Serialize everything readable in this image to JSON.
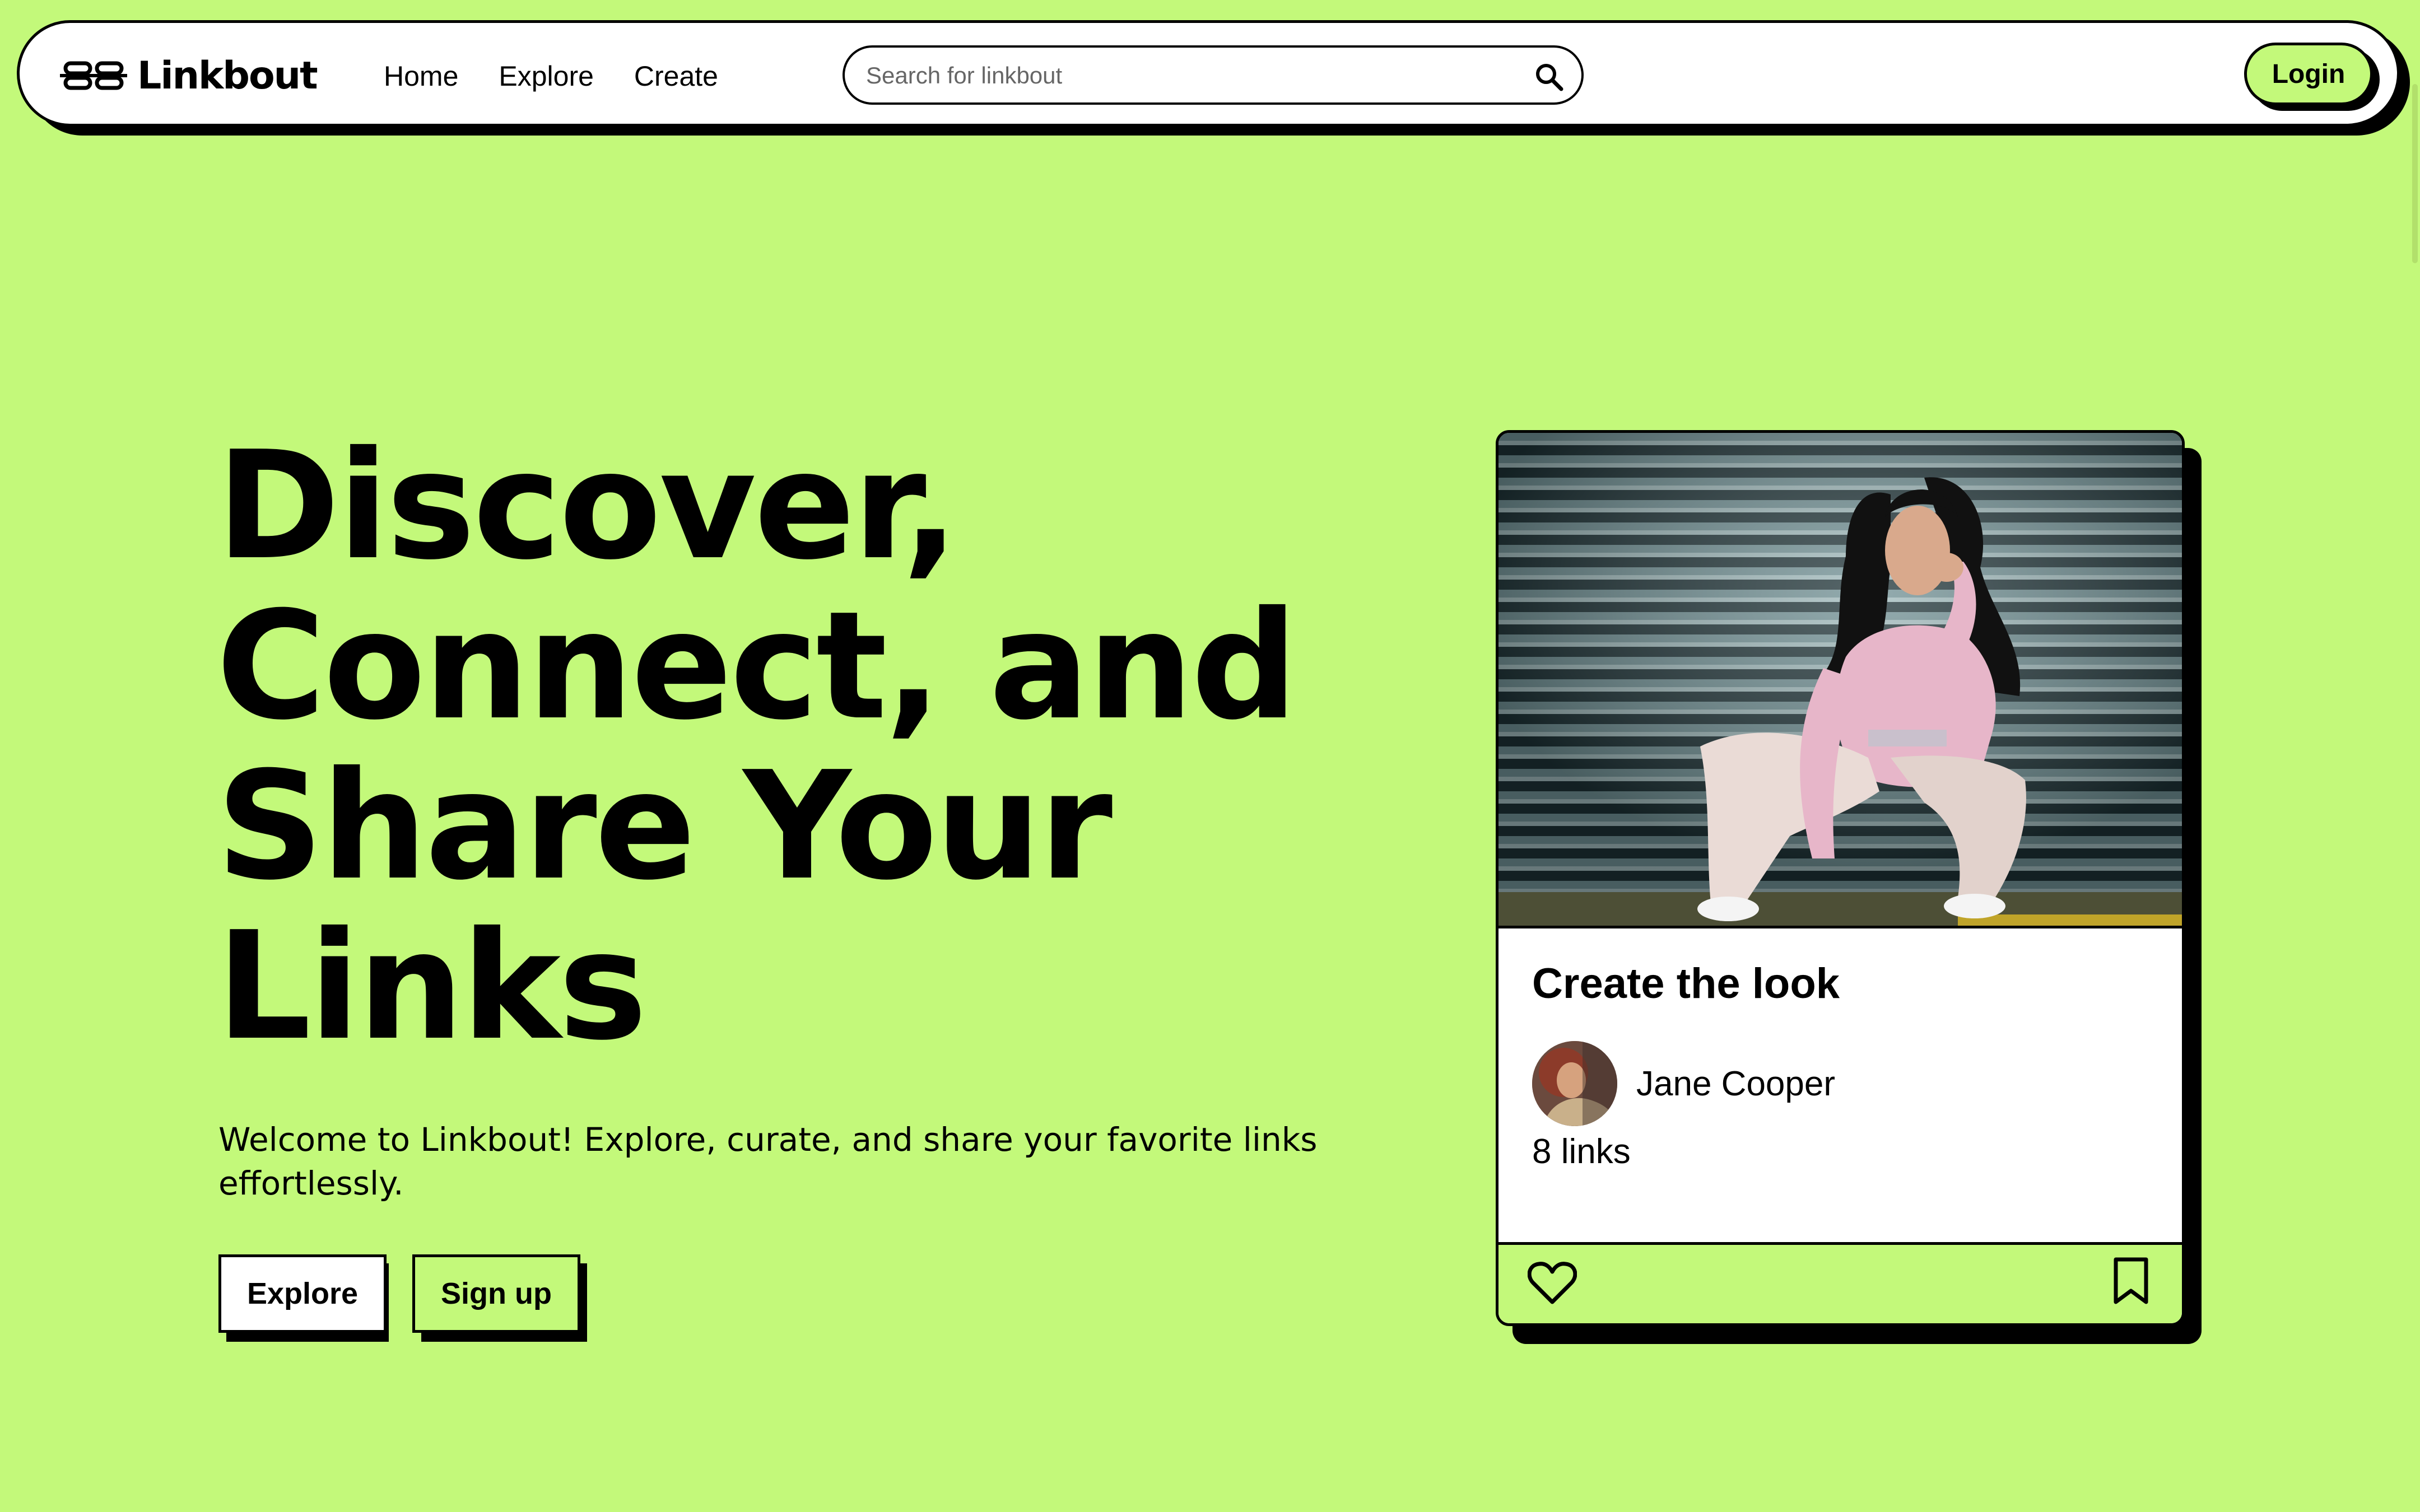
{
  "header": {
    "logo_text": "Linkbout",
    "logo_icon": "chain-link-icon",
    "nav": [
      {
        "label": "Home"
      },
      {
        "label": "Explore"
      },
      {
        "label": "Create"
      }
    ],
    "search": {
      "placeholder": "Search for linkbout",
      "icon": "search-icon"
    },
    "login_label": "Login"
  },
  "hero": {
    "title_lines": [
      "Discover,",
      "Connect, and",
      "Share Your",
      "Links"
    ],
    "subtitle": "Welcome to Linkbout! Explore, curate, and share your favorite links effortlessly.",
    "explore_label": "Explore",
    "signup_label": "Sign up"
  },
  "card": {
    "title": "Create the look",
    "author": "Jane Cooper",
    "links_count": "8 links",
    "like_icon": "heart-icon",
    "save_icon": "bookmark-icon"
  },
  "colors": {
    "background": "#c3f97a",
    "accent": "#c3f97a",
    "ink": "#000000",
    "surface": "#ffffff"
  }
}
